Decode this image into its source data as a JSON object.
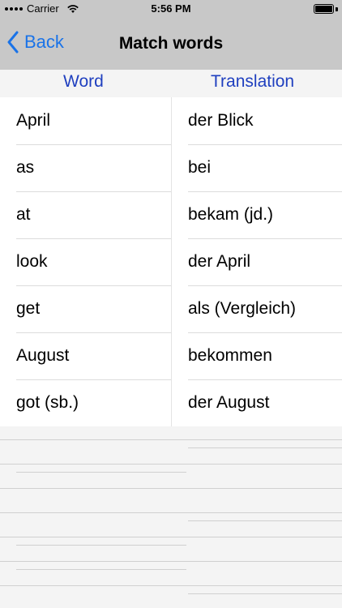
{
  "status_bar": {
    "carrier": "Carrier",
    "time": "5:56 PM"
  },
  "nav": {
    "back_label": "Back",
    "title": "Match words"
  },
  "columns": {
    "word_header": "Word",
    "translation_header": "Translation"
  },
  "words": [
    "April",
    "as",
    "at",
    "look",
    "get",
    "August",
    "got (sb.)"
  ],
  "translations": [
    "der Blick",
    "bei",
    "bekam (jd.)",
    "der April",
    "als (Vergleich)",
    "bekommen",
    "der August"
  ],
  "colors": {
    "accent": "#1a73e8",
    "header_text": "#1f3fbf",
    "bar_background": "#c8c8c8"
  }
}
